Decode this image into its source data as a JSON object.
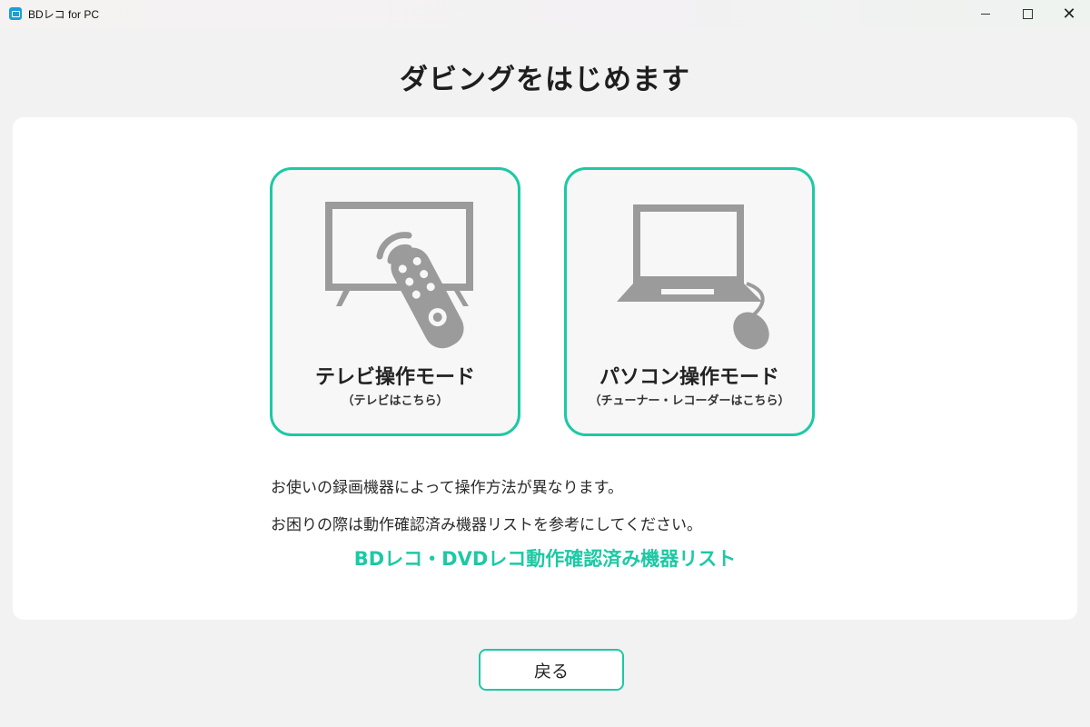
{
  "window": {
    "title": "BDレコ for PC",
    "controls": {
      "minimize": "minimize-icon",
      "maximize": "maximize-icon",
      "close": "✕"
    }
  },
  "page": {
    "title": "ダビングをはじめます"
  },
  "modes": [
    {
      "label": "テレビ操作モード",
      "sub": "（テレビはこちら）",
      "icon": "tv-remote-icon"
    },
    {
      "label": "パソコン操作モード",
      "sub": "（チューナー・レコーダーはこちら）",
      "icon": "laptop-mouse-icon"
    }
  ],
  "info": {
    "line1": "お使いの録画機器によって操作方法が異なります。",
    "line2": "お困りの際は動作確認済み機器リストを参考にしてください。"
  },
  "link": {
    "label": "BDレコ・DVDレコ動作確認済み機器リスト"
  },
  "back": {
    "label": "戻る"
  },
  "colors": {
    "accent": "#1dc9a4",
    "icon_gray": "#9b9b9b"
  }
}
